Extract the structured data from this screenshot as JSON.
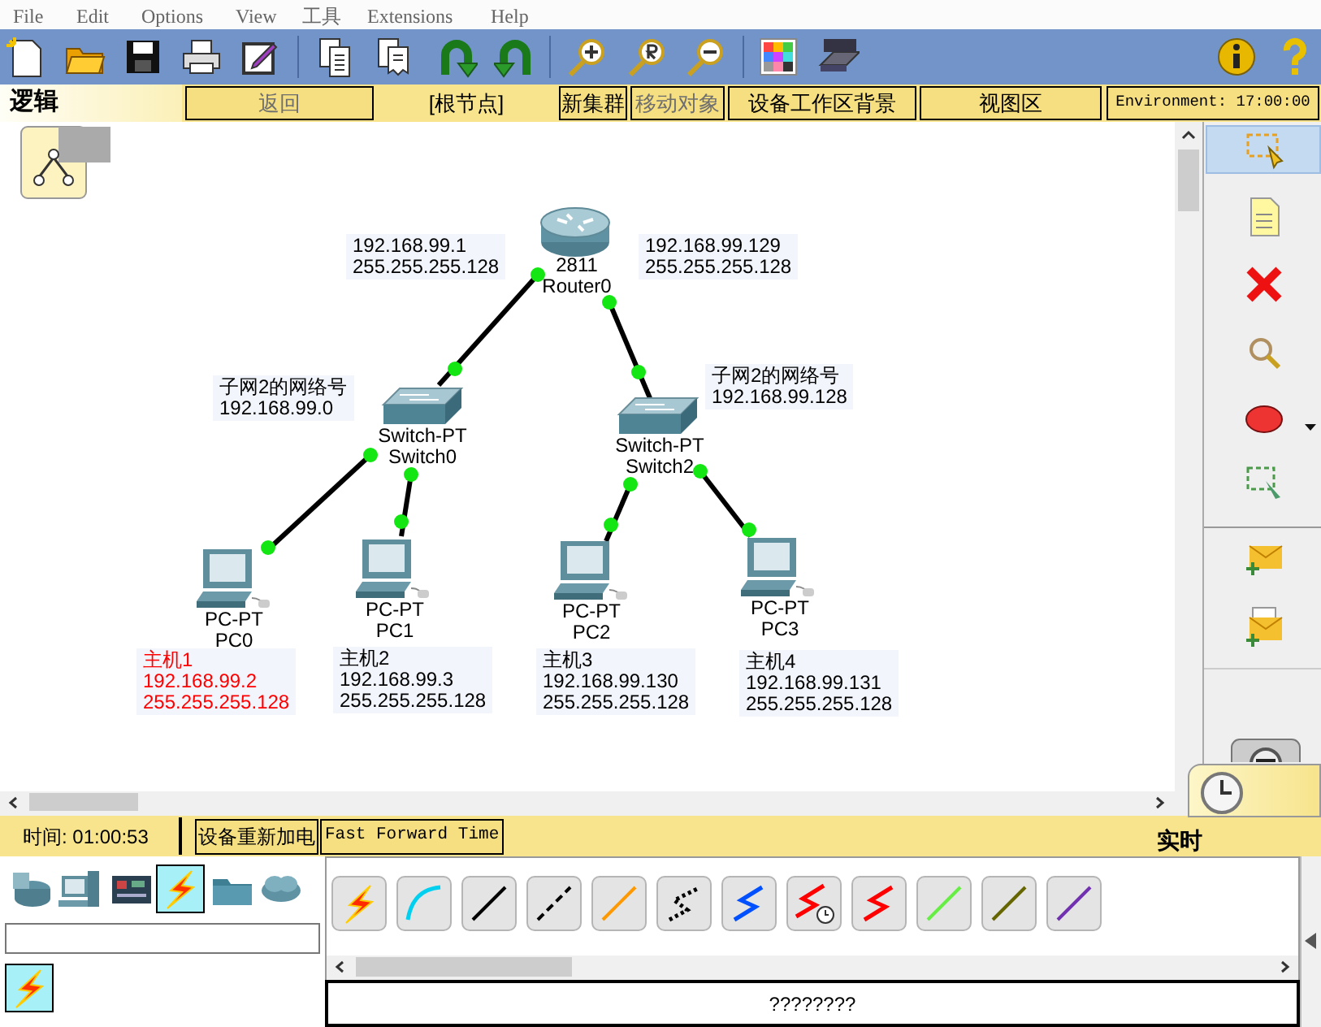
{
  "menu_bar": [
    "File",
    "Edit",
    "Options",
    "View",
    "工具",
    "Extensions",
    "Help"
  ],
  "workspace_bar": {
    "mode_tab": "逻辑",
    "buttons": [
      {
        "label": "返回",
        "kind": "button",
        "disabled": true
      },
      {
        "label": "[根节点]",
        "kind": "label",
        "disabled": false
      },
      {
        "label": "新集群",
        "kind": "button",
        "disabled": false
      },
      {
        "label": "移动对象",
        "kind": "button",
        "disabled": true
      },
      {
        "label": "设备工作区背景",
        "kind": "button",
        "disabled": false
      },
      {
        "label": "视图区",
        "kind": "button",
        "disabled": false
      }
    ],
    "environment": "Environment: 17:00:00"
  },
  "topology": {
    "devices": [
      {
        "kind": "router",
        "model": "2811",
        "name": "Router0"
      },
      {
        "kind": "switch",
        "model": "Switch-PT",
        "name": "Switch0"
      },
      {
        "kind": "switch",
        "model": "Switch-PT",
        "name": "Switch2"
      },
      {
        "kind": "pc",
        "model": "PC-PT",
        "name": "PC0"
      },
      {
        "kind": "pc",
        "model": "PC-PT",
        "name": "PC1"
      },
      {
        "kind": "pc",
        "model": "PC-PT",
        "name": "PC2"
      },
      {
        "kind": "pc",
        "model": "PC-PT",
        "name": "PC3"
      }
    ],
    "notes": [
      {
        "text": "192.168.99.1\n255.255.255.128",
        "color": "#000000"
      },
      {
        "text": "192.168.99.129\n255.255.255.128",
        "color": "#000000"
      },
      {
        "text": "子网2的网络号\n192.168.99.0",
        "color": "#000000"
      },
      {
        "text": "子网2的网络号\n192.168.99.128",
        "color": "#000000"
      },
      {
        "text": "主机1\n192.168.99.2\n255.255.255.128",
        "color": "#ff0000"
      },
      {
        "text": "主机2\n192.168.99.3\n255.255.255.128",
        "color": "#000000"
      },
      {
        "text": "主机3\n192.168.99.130\n255.255.255.128",
        "color": "#000000"
      },
      {
        "text": "主机4\n192.168.99.131\n255.255.255.128",
        "color": "#000000"
      }
    ]
  },
  "tools": [
    {
      "selected": true
    },
    {
      "selected": false
    },
    {
      "selected": false
    },
    {
      "selected": false
    },
    {
      "selected": false
    },
    {
      "selected": false
    },
    {
      "selected": false
    },
    {
      "selected": false
    }
  ],
  "time_bar": {
    "time": "时间: 01:00:53",
    "power_cycle_button": "设备重新加电",
    "fast_forward_button": "Fast Forward Time",
    "mode": "实时"
  },
  "device_categories": [
    {
      "selected": false
    },
    {
      "selected": false
    },
    {
      "selected": false
    },
    {
      "selected": true
    },
    {
      "selected": false
    },
    {
      "selected": false
    }
  ],
  "cable_types": [
    {
      "kind": "auto",
      "color": "#ff2a00"
    },
    {
      "kind": "curve",
      "color": "#00d0f0"
    },
    {
      "kind": "line",
      "color": "#000000"
    },
    {
      "kind": "dashed",
      "color": "#000000"
    },
    {
      "kind": "line",
      "color": "#ff9900"
    },
    {
      "kind": "dotted-zigzag",
      "color": "#000000"
    },
    {
      "kind": "zigzag",
      "color": "#0050ff"
    },
    {
      "kind": "zigzag-clock",
      "color": "#ff0000"
    },
    {
      "kind": "zigzag",
      "color": "#ff0000"
    },
    {
      "kind": "line",
      "color": "#66ee44"
    },
    {
      "kind": "line",
      "color": "#666600"
    },
    {
      "kind": "line",
      "color": "#7030b0"
    }
  ],
  "status_field": "????????"
}
